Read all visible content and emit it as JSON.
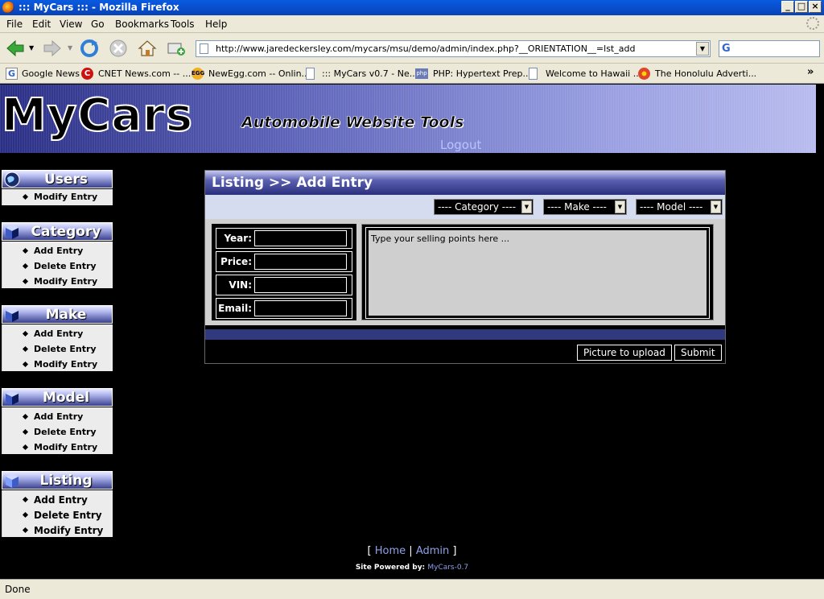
{
  "window": {
    "title": "::: MyCars ::: - Mozilla Firefox"
  },
  "menu": [
    "File",
    "Edit",
    "View",
    "Go",
    "Bookmarks",
    "Tools",
    "Help"
  ],
  "url": "http://www.jaredeckersley.com/mycars/msu/demo/admin/index.php?__ORIENTATION__=lst_add",
  "search": {
    "logo": "G"
  },
  "bookmarks": [
    {
      "label": "Google News",
      "icon": "google-icon"
    },
    {
      "label": "CNET News.com -- ...",
      "icon": "cnet-icon"
    },
    {
      "label": "NewEgg.com -- Onlin...",
      "icon": "newegg-icon"
    },
    {
      "label": "::: MyCars v0.7 - Ne...",
      "icon": "page-icon"
    },
    {
      "label": "PHP: Hypertext Prep...",
      "icon": "php-icon"
    },
    {
      "label": "Welcome to Hawaii ...",
      "icon": "page-icon"
    },
    {
      "label": "The Honolulu Adverti...",
      "icon": "flower-icon"
    }
  ],
  "banner": {
    "logo": "MyCars",
    "tagline": "Automobile Website Tools",
    "logout": "Logout"
  },
  "sidebar": [
    {
      "title": "Users",
      "icon": "globe-icon",
      "items": [
        "Modify Entry"
      ]
    },
    {
      "title": "Category",
      "icon": "cube-icon",
      "items": [
        "Add Entry",
        "Delete Entry",
        "Modify Entry"
      ]
    },
    {
      "title": "Make",
      "icon": "cube-icon",
      "items": [
        "Add Entry",
        "Delete Entry",
        "Modify Entry"
      ]
    },
    {
      "title": "Model",
      "icon": "cube-icon",
      "items": [
        "Add Entry",
        "Delete Entry",
        "Modify Entry"
      ]
    },
    {
      "title": "Listing",
      "icon": "cube-icon",
      "items": [
        "Add Entry",
        "Delete Entry",
        "Modify Entry"
      ]
    }
  ],
  "listing": {
    "title": "Listing >> Add Entry",
    "selects": {
      "category": "---- Category ----",
      "make": "---- Make ----",
      "model": "---- Model ----"
    },
    "fields": {
      "year": "Year:",
      "price": "Price:",
      "vin": "VIN:",
      "email": "Email:"
    },
    "description_placeholder": "Type your selling points here ...",
    "buttons": {
      "picture": "Picture to upload",
      "submit": "Submit"
    }
  },
  "footer": {
    "open": "[",
    "home": "Home",
    "sep": "|",
    "admin": "Admin",
    "close": "]",
    "powered_label": "Site Powered by:",
    "powered_link": "MyCars-0.7"
  },
  "status": "Done",
  "colors": {
    "accent": "#2a2f7d",
    "link": "#8fa0e8",
    "panel_bg": "#d0d0d0"
  }
}
